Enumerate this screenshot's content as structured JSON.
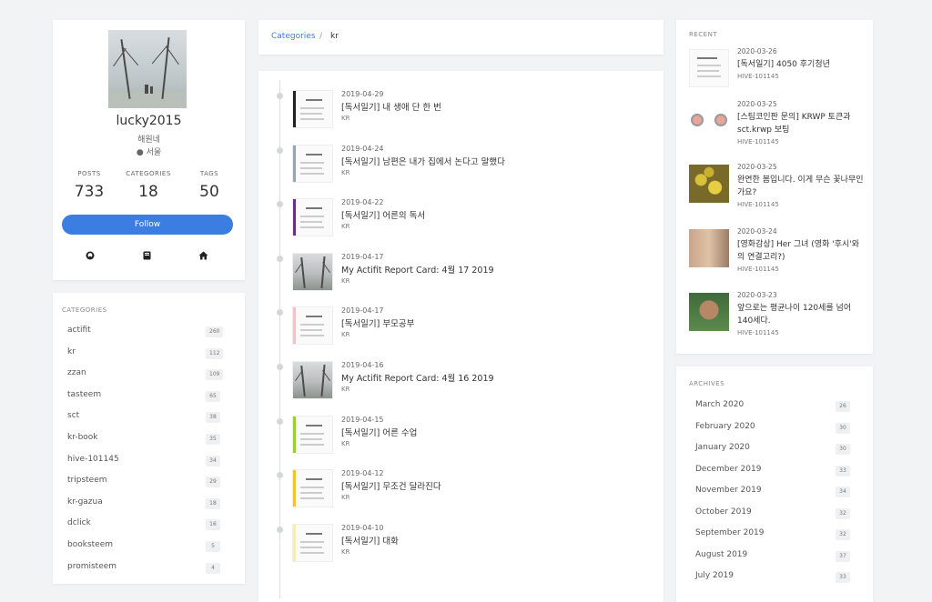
{
  "profile": {
    "name": "lucky2015",
    "subtitle": "해원네",
    "location": "서울",
    "stats": [
      {
        "label": "POSTS",
        "value": "733"
      },
      {
        "label": "CATEGORIES",
        "value": "18"
      },
      {
        "label": "TAGS",
        "value": "50"
      }
    ],
    "follow_label": "Follow",
    "social_icons": [
      "github-icon",
      "book-icon",
      "home-icon"
    ]
  },
  "categories": {
    "title": "CATEGORIES",
    "items": [
      {
        "name": "actifit",
        "count": "260"
      },
      {
        "name": "kr",
        "count": "112"
      },
      {
        "name": "zzan",
        "count": "109"
      },
      {
        "name": "tasteem",
        "count": "65"
      },
      {
        "name": "sct",
        "count": "38"
      },
      {
        "name": "kr-book",
        "count": "35"
      },
      {
        "name": "hive-101145",
        "count": "34"
      },
      {
        "name": "tripsteem",
        "count": "29"
      },
      {
        "name": "kr-gazua",
        "count": "18"
      },
      {
        "name": "dclick",
        "count": "16"
      },
      {
        "name": "booksteem",
        "count": "5"
      },
      {
        "name": "promisteem",
        "count": "4"
      }
    ]
  },
  "breadcrumb": {
    "link": "Categories",
    "separator": "/",
    "current": "kr"
  },
  "timeline": [
    {
      "date": "2019-04-29",
      "title": "[독서일기] 내 생애 단 한 번",
      "tag": "KR",
      "thumb": "doc",
      "accent": "#222222"
    },
    {
      "date": "2019-04-24",
      "title": "[독서일기] 남편은 내가 집에서 논다고 말했다",
      "tag": "KR",
      "thumb": "doc",
      "accent": "#9aa3b5"
    },
    {
      "date": "2019-04-22",
      "title": "[독서일기] 어른의 독서",
      "tag": "KR",
      "thumb": "doc",
      "accent": "#6b2f8a"
    },
    {
      "date": "2019-04-17",
      "title": "My Actifit Report Card: 4월 17 2019",
      "tag": "KR",
      "thumb": "photo",
      "accent": "#777777"
    },
    {
      "date": "2019-04-17",
      "title": "[독서일기] 부모공부",
      "tag": "KR",
      "thumb": "doc",
      "accent": "#f2c4c8"
    },
    {
      "date": "2019-04-16",
      "title": "My Actifit Report Card: 4월 16 2019",
      "tag": "KR",
      "thumb": "photo",
      "accent": "#777777"
    },
    {
      "date": "2019-04-15",
      "title": "[독서일기] 어른 수업",
      "tag": "KR",
      "thumb": "doc",
      "accent": "#9acd32"
    },
    {
      "date": "2019-04-12",
      "title": "[독서일기] 무조건 달라진다",
      "tag": "KR",
      "thumb": "doc",
      "accent": "#f2c230"
    },
    {
      "date": "2019-04-10",
      "title": "[독서일기] 대화",
      "tag": "KR",
      "thumb": "doc",
      "accent": "#f5f0b0"
    }
  ],
  "recent": {
    "title": "RECENT",
    "items": [
      {
        "date": "2020-03-26",
        "title": "[독서일기] 4050 후기청년",
        "tag": "HIVE-101145",
        "thumb": "doc"
      },
      {
        "date": "2020-03-25",
        "title": "[스팀코인판 문의] KRWP 토큰과 sct.krwp 보팅",
        "tag": "HIVE-101145",
        "thumb": "coins"
      },
      {
        "date": "2020-03-25",
        "title": "완연한 봄입니다. 이게 무슨 꽃나무인가요?",
        "tag": "HIVE-101145",
        "thumb": "flowers"
      },
      {
        "date": "2020-03-24",
        "title": "[영화감상] Her 그녀 (영화 '후시'와의 연결고리?)",
        "tag": "HIVE-101145",
        "thumb": "portrait"
      },
      {
        "date": "2020-03-23",
        "title": "앞으로는 평균나이 120세를 넘어 140세다.",
        "tag": "HIVE-101145",
        "thumb": "elder"
      }
    ]
  },
  "archives": {
    "title": "ARCHIVES",
    "items": [
      {
        "month": "March 2020",
        "count": "26"
      },
      {
        "month": "February 2020",
        "count": "30"
      },
      {
        "month": "January 2020",
        "count": "30"
      },
      {
        "month": "December 2019",
        "count": "33"
      },
      {
        "month": "November 2019",
        "count": "34"
      },
      {
        "month": "October 2019",
        "count": "32"
      },
      {
        "month": "September 2019",
        "count": "32"
      },
      {
        "month": "August 2019",
        "count": "37"
      },
      {
        "month": "July 2019",
        "count": "33"
      }
    ]
  },
  "colors": {
    "accent": "#3b7de0",
    "background": "#f2f3f5",
    "badge": "#eef0f2"
  }
}
